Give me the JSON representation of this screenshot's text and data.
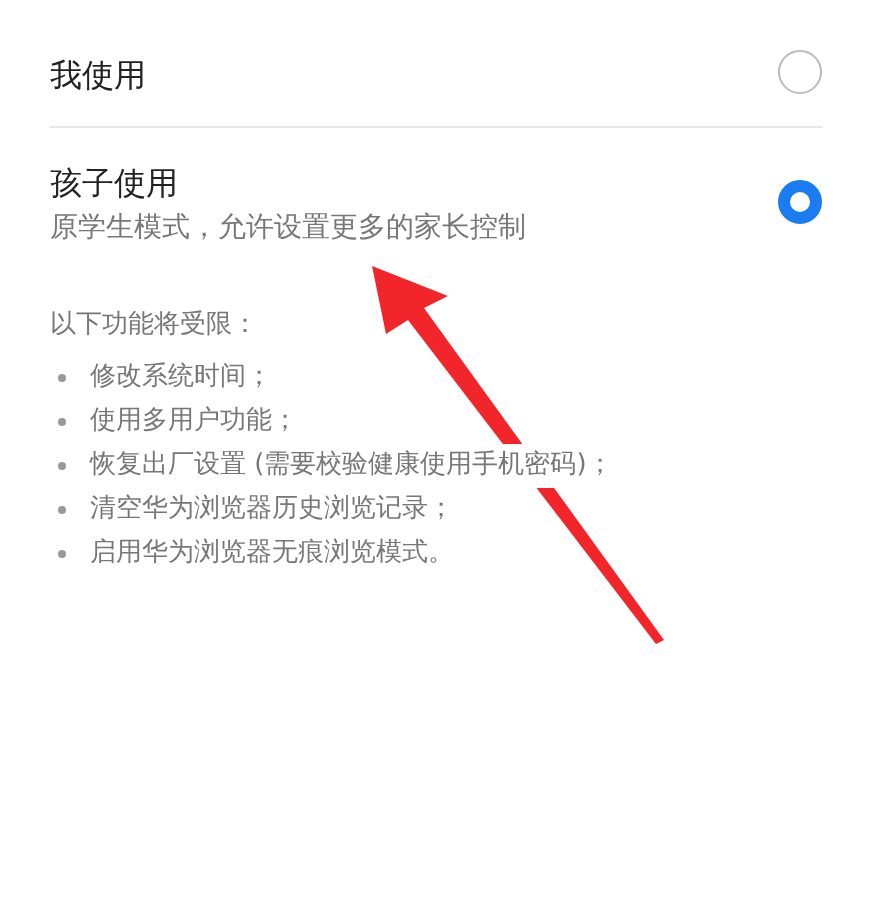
{
  "options": [
    {
      "title": "我使用",
      "selected": false
    },
    {
      "title": "孩子使用",
      "subtitle": "原学生模式，允许设置更多的家长控制",
      "selected": true
    }
  ],
  "limits": {
    "heading": "以下功能将受限：",
    "items": [
      "修改系统时间；",
      "使用多用户功能；",
      "恢复出厂设置 (需要校验健康使用手机密码)；",
      "清空华为浏览器历史浏览记录；",
      "启用华为浏览器无痕浏览模式。"
    ]
  }
}
